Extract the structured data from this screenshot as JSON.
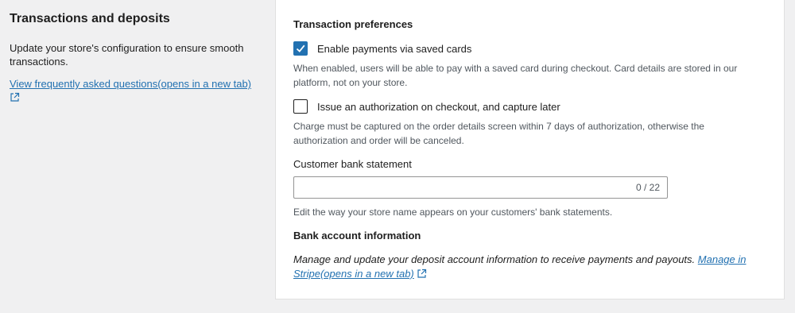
{
  "left": {
    "title": "Transactions and deposits",
    "description": "Update your store's configuration to ensure smooth transactions.",
    "faq_link": "View frequently asked questions(opens in a new tab)"
  },
  "card": {
    "transaction_preferences_title": "Transaction preferences",
    "saved_cards": {
      "label": "Enable payments via saved cards",
      "checked": true,
      "help": "When enabled, users will be able to pay with a saved card during checkout. Card details are stored in our platform, not on your store."
    },
    "authorization": {
      "label": "Issue an authorization on checkout, and capture later",
      "checked": false,
      "help": "Charge must be captured on the order details screen within 7 days of authorization, otherwise the authorization and order will be canceled."
    },
    "bank_statement": {
      "label": "Customer bank statement",
      "value": "",
      "counter": "0 / 22",
      "help": "Edit the way your store name appears on your customers' bank statements."
    },
    "bank_account": {
      "title": "Bank account information",
      "text": "Manage and update your deposit account information to receive payments and payouts.",
      "link": "Manage in Stripe(opens in a new tab)"
    }
  },
  "colors": {
    "accent": "#2271b1",
    "background": "#f0f0f1",
    "card": "#ffffff"
  },
  "icons": {
    "external": "external-link-icon",
    "check": "checkmark-icon"
  }
}
